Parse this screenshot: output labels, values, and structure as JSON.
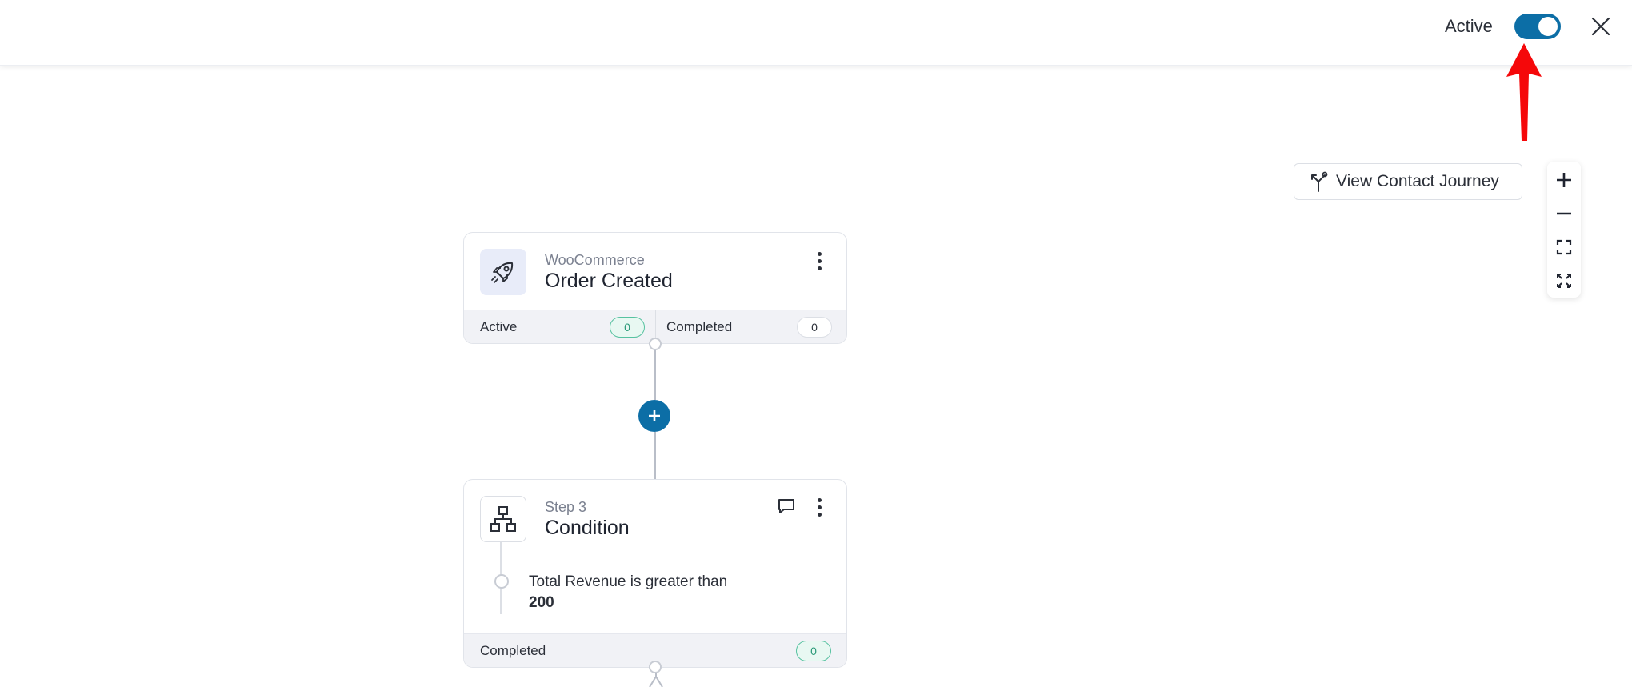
{
  "header": {
    "active_label": "Active",
    "toggle_on": true,
    "accent_color": "#0c6ea6"
  },
  "toolbar": {
    "journey_button_label": "View Contact Journey",
    "journey_icon": "branch-icon",
    "zoom": [
      "zoom-in-icon",
      "zoom-out-icon",
      "fit-view-icon",
      "fullscreen-icon"
    ]
  },
  "trigger_card": {
    "subtitle": "WooCommerce",
    "title": "Order Created",
    "icon": "rocket-icon",
    "stats": {
      "active_label": "Active",
      "active_count": "0",
      "completed_label": "Completed",
      "completed_count": "0"
    }
  },
  "add_step": {
    "icon": "plus-icon"
  },
  "condition_card": {
    "subtitle": "Step 3",
    "title": "Condition",
    "icon": "hierarchy-icon",
    "rule_text": "Total Revenue is greater than",
    "rule_value": "200",
    "stats": {
      "completed_label": "Completed",
      "completed_count": "0"
    }
  }
}
